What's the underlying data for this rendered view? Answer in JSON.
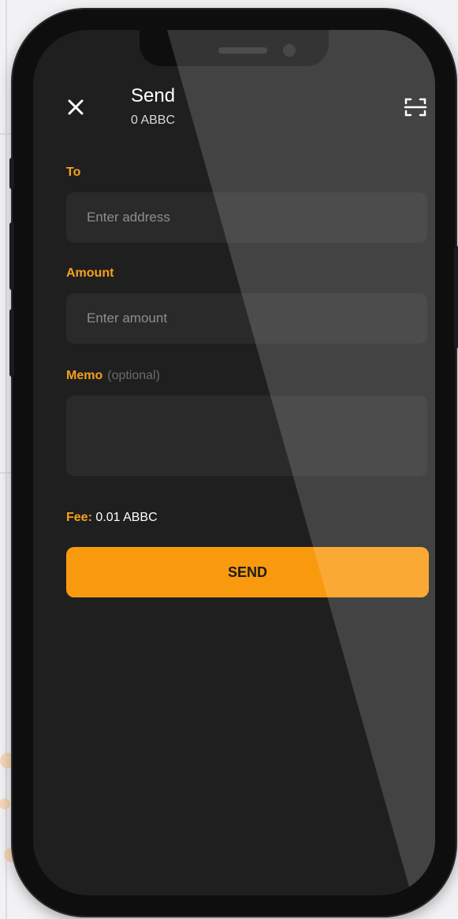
{
  "header": {
    "title": "Send",
    "balance": "0 ABBC"
  },
  "icons": {
    "close": "close-icon",
    "scan": "qr-scan-icon"
  },
  "form": {
    "to_label": "To",
    "address_placeholder": "Enter address",
    "address_value": "",
    "amount_label": "Amount",
    "amount_placeholder": "Enter amount",
    "amount_value": "",
    "memo_label": "Memo",
    "memo_hint": "(optional)",
    "memo_value": ""
  },
  "fee": {
    "label": "Fee:",
    "value": "0.01 ABBC"
  },
  "actions": {
    "send_label": "SEND"
  },
  "colors": {
    "accent": "#f99a0e",
    "label": "#f7a01c",
    "screen_bg": "#1f1f20",
    "field_bg": "#2a2a2b"
  }
}
